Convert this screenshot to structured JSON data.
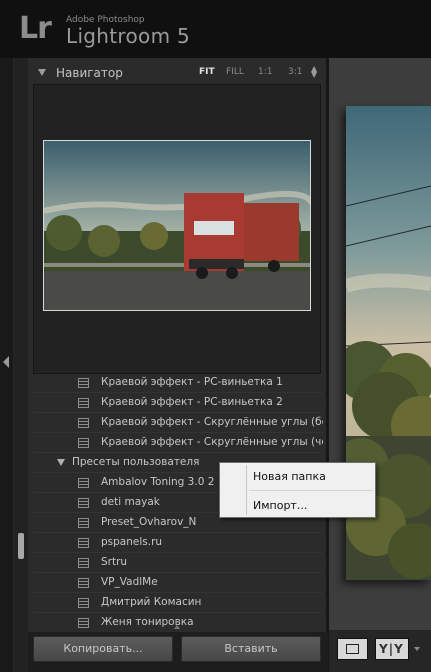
{
  "app": {
    "brand_small": "Adobe Photoshop",
    "brand_big": "Lightroom 5",
    "logo": "Lr"
  },
  "navigator": {
    "title": "Навигатор",
    "zoom_options": [
      "FIT",
      "FILL",
      "1:1",
      "3:1"
    ],
    "zoom_spin_icon": "up-down-spinner-icon"
  },
  "presets": {
    "items_before": [
      "Краевой эффект - PC-виньетка 1",
      "Краевой эффект - PC-виньетка 2",
      "Краевой эффект - Скруглённые углы (бел...",
      "Краевой эффект - Скруглённые углы (чёр..."
    ],
    "user_folder": "Пресеты пользователя",
    "user_items": [
      "Ambalov Toning 3.0 2",
      "deti mayak",
      "Preset_Ovharov_N",
      "pspanels.ru",
      "Srtru",
      "VP_VadlMe",
      "Дмитрий Комасин",
      "Женя тонировка"
    ]
  },
  "buttons": {
    "copy": "Копировать...",
    "paste": "Вставить"
  },
  "toolbar": {
    "yy_label": "Y|Y"
  },
  "context_menu": {
    "new_folder": "Новая папка",
    "import": "Импорт..."
  }
}
